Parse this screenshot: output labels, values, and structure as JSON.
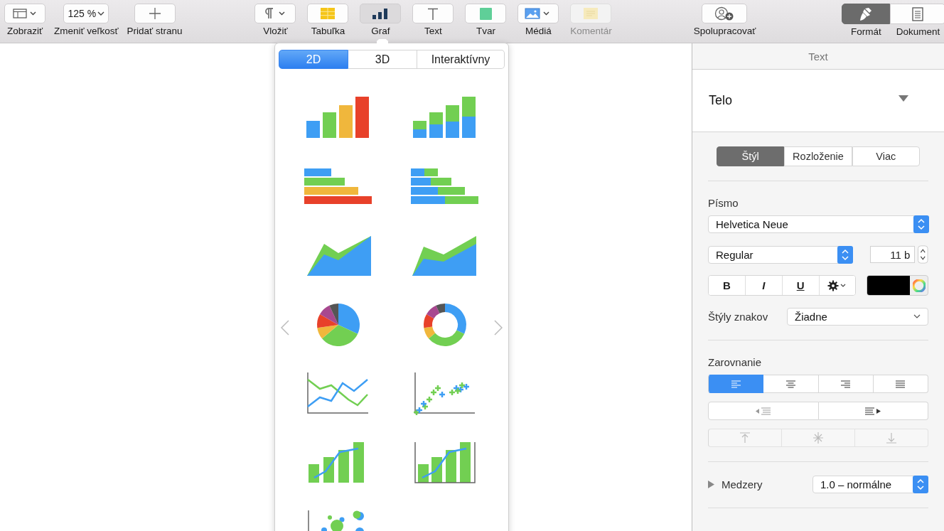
{
  "toolbar": {
    "items": [
      {
        "kind": "view",
        "label": "Zobraziť",
        "active": false,
        "disabled": false
      },
      {
        "kind": "zoom",
        "label": "Zmeniť veľkosť",
        "value": "125 %",
        "active": false,
        "disabled": false
      },
      {
        "kind": "add-page",
        "label": "Pridať stranu",
        "active": false,
        "disabled": false
      },
      {
        "kind": "insert",
        "label": "Vložiť",
        "active": false,
        "disabled": false
      },
      {
        "kind": "table",
        "label": "Tabuľka",
        "active": false,
        "disabled": false
      },
      {
        "kind": "chart",
        "label": "Graf",
        "active": true,
        "disabled": false
      },
      {
        "kind": "text",
        "label": "Text",
        "active": false,
        "disabled": false
      },
      {
        "kind": "shape",
        "label": "Tvar",
        "active": false,
        "disabled": false
      },
      {
        "kind": "media",
        "label": "Médiá",
        "active": false,
        "disabled": false
      },
      {
        "kind": "comment",
        "label": "Komentár",
        "active": false,
        "disabled": true
      },
      {
        "kind": "collaborate",
        "label": "Spolupracovať",
        "active": false,
        "disabled": false
      }
    ],
    "panes": [
      {
        "kind": "format",
        "label": "Formát",
        "selected": true
      },
      {
        "kind": "document",
        "label": "Dokument",
        "selected": false
      }
    ]
  },
  "chart_popover": {
    "tabs": [
      {
        "label": "2D",
        "selected": true
      },
      {
        "label": "3D",
        "selected": false
      },
      {
        "label": "Interaktívny",
        "selected": false
      }
    ],
    "chart_types": [
      {
        "kind": "column"
      },
      {
        "kind": "stacked-column"
      },
      {
        "kind": "bar"
      },
      {
        "kind": "stacked-bar"
      },
      {
        "kind": "area"
      },
      {
        "kind": "stacked-area"
      },
      {
        "kind": "pie"
      },
      {
        "kind": "donut"
      },
      {
        "kind": "line"
      },
      {
        "kind": "scatter"
      },
      {
        "kind": "mixed"
      },
      {
        "kind": "two-axis"
      },
      {
        "kind": "bubble"
      }
    ]
  },
  "inspector": {
    "title": "Text",
    "paragraph_style": "Telo",
    "tabs": [
      {
        "label": "Štýl",
        "selected": true
      },
      {
        "label": "Rozloženie",
        "selected": false
      },
      {
        "label": "Viac",
        "selected": false
      }
    ],
    "font": {
      "heading": "Písmo",
      "family": "Helvetica Neue",
      "typeface": "Regular",
      "size": "11 b",
      "style_buttons": [
        {
          "kind": "bold",
          "label": "B"
        },
        {
          "kind": "italic",
          "label": "I"
        },
        {
          "kind": "underline",
          "label": "U"
        }
      ],
      "character_styles_label": "Štýly znakov",
      "character_style": "Žiadne"
    },
    "alignment": {
      "heading": "Zarovnanie",
      "horizontal": [
        {
          "kind": "left",
          "selected": true
        },
        {
          "kind": "center",
          "selected": false
        },
        {
          "kind": "right",
          "selected": false
        },
        {
          "kind": "justify",
          "selected": false
        }
      ],
      "vertical": [
        {
          "kind": "top",
          "disabled": true
        },
        {
          "kind": "middle",
          "disabled": true
        },
        {
          "kind": "bottom",
          "disabled": true
        }
      ]
    },
    "spacing": {
      "label": "Medzery",
      "value": "1.0 – normálne",
      "expanded": false
    }
  }
}
